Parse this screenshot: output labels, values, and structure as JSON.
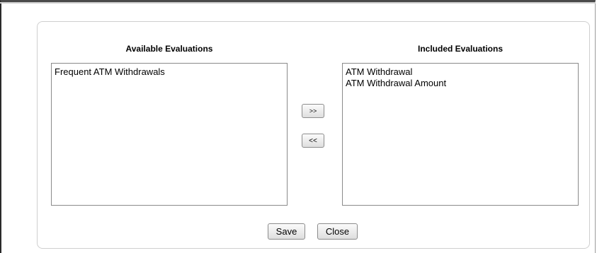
{
  "available": {
    "title": "Available Evaluations",
    "items": [
      "Frequent ATM Withdrawals"
    ]
  },
  "included": {
    "title": "Included Evaluations",
    "items": [
      "ATM Withdrawal",
      "ATM Withdrawal Amount"
    ]
  },
  "controls": {
    "move_right_label": ">>",
    "move_left_label": "<<"
  },
  "footer": {
    "save_label": "Save",
    "close_label": "Close"
  }
}
